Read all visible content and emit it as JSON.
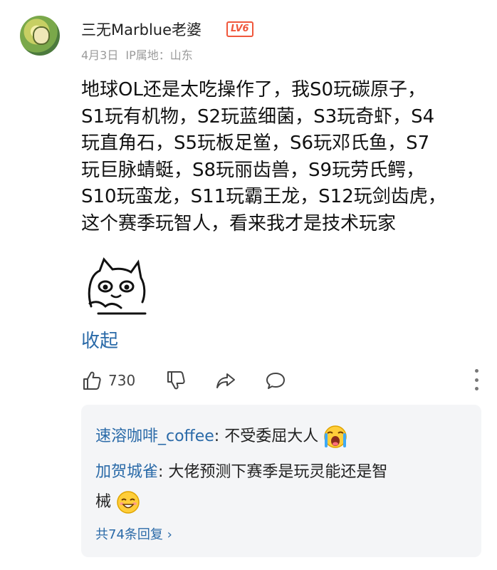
{
  "comment": {
    "username": "三无Marblue老婆",
    "level_badge": "LV6",
    "date": "4月3日",
    "ip_location": "IP属地：山东",
    "text_lines": [
      "地球OL还是太吃操作了，我S0玩碳原子，",
      "S1玩有机物，S2玩蓝细菌，S3玩奇虾，S4",
      "玩直角石，S5玩板足鲎，S6玩邓氏鱼，S7",
      "玩巨脉蜻蜓，S8玩丽齿兽，S9玩劳氏鳄，",
      "S10玩蛮龙，S11玩霸王龙，S12玩剑齿虎，",
      "这个赛季玩智人，看来我才是技术玩家"
    ],
    "sticker": "cat-sticker",
    "collapse_label": "收起"
  },
  "actions": {
    "like_count": "730",
    "icons": [
      "thumbs-up-icon",
      "thumbs-down-icon",
      "share-icon",
      "comment-icon",
      "more-icon"
    ]
  },
  "replies": {
    "items": [
      {
        "name": "速溶咖啡_coffee",
        "sep": ": ",
        "text": "不受委屈大人",
        "emoji": "crying-emoji"
      },
      {
        "name": "加贺城雀",
        "sep": ": ",
        "text": "大佬预测下赛季是玩灵能还是智",
        "text2": "械",
        "emoji": "smiling-emoji"
      }
    ],
    "view_more": "共74条回复 ›"
  },
  "colors": {
    "link": "#2a6aa8",
    "badge": "#f0573c",
    "meta": "#9b9b9b",
    "reply_bg": "#f4f5f7"
  }
}
